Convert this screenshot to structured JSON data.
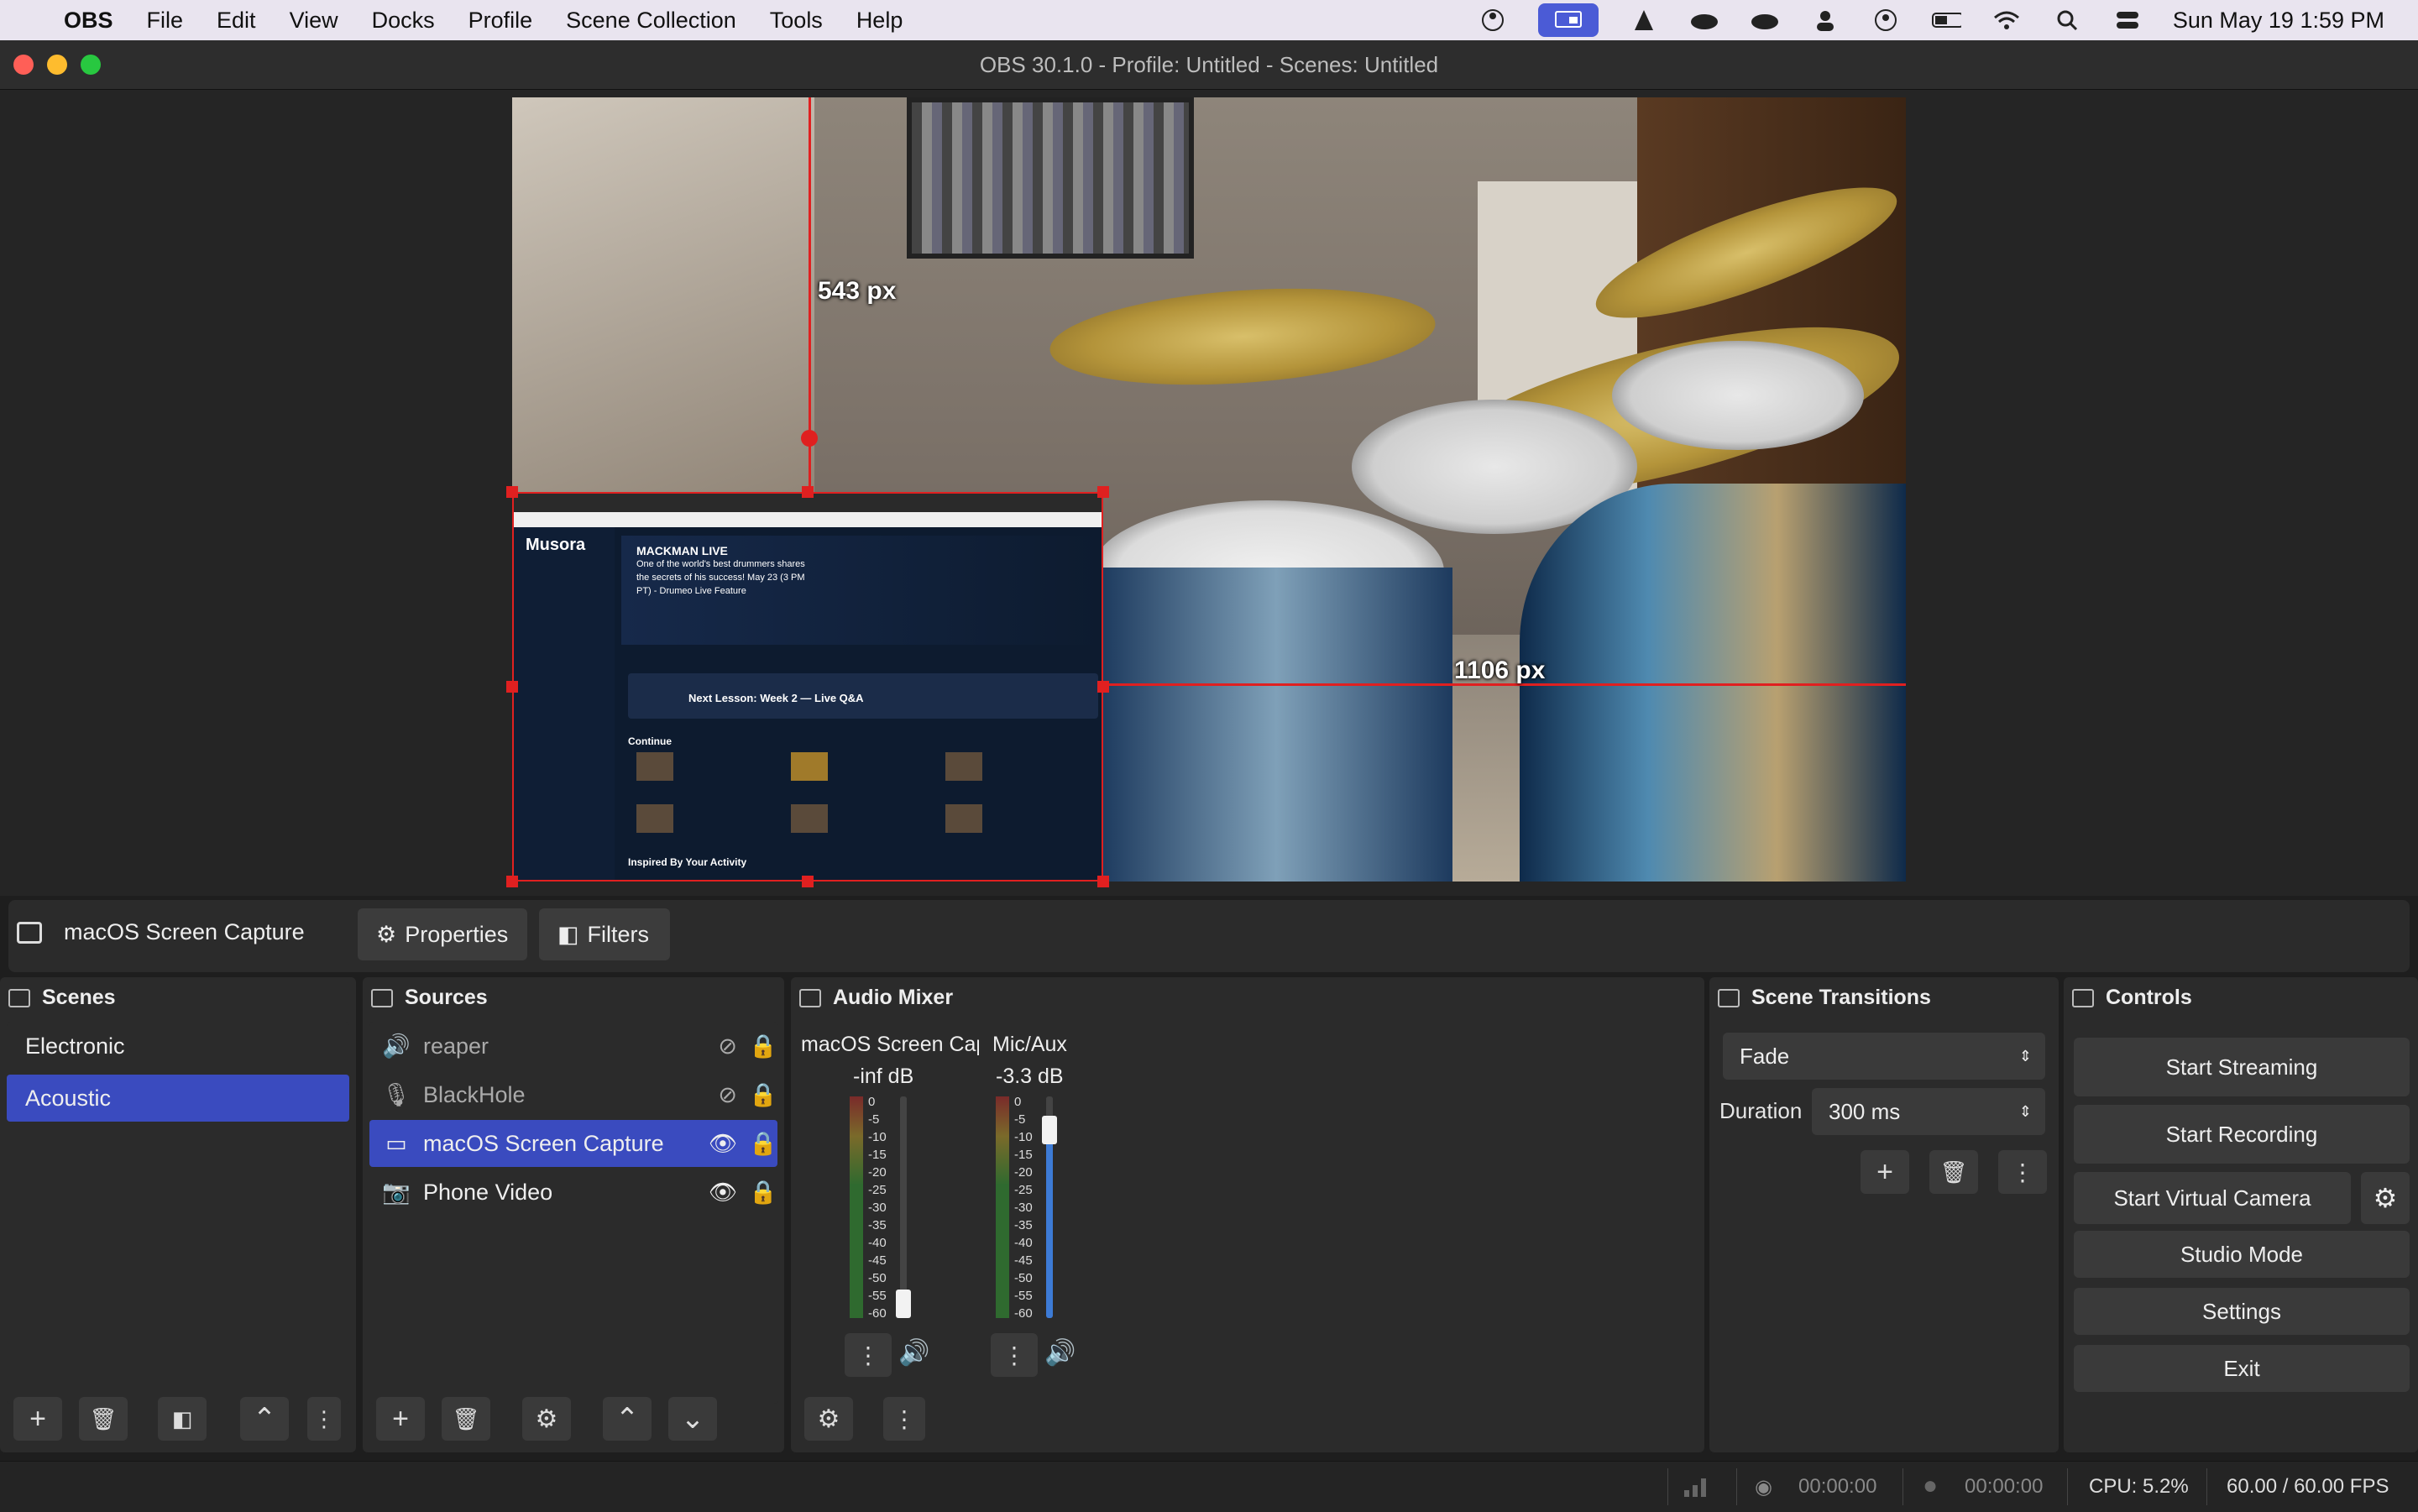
{
  "menubar": {
    "app": "OBS",
    "items": [
      "File",
      "Edit",
      "View",
      "Docks",
      "Profile",
      "Scene Collection",
      "Tools",
      "Help"
    ],
    "datetime": "Sun May 19  1:59 PM"
  },
  "window": {
    "title": "OBS 30.1.0 - Profile: Untitled - Scenes: Untitled"
  },
  "preview": {
    "guide_vertical_label": "543 px",
    "guide_horizontal_label": "1106 px",
    "capture": {
      "logo": "Musora",
      "banner_title": "MACKMAN LIVE",
      "banner_text": "One of the world's best drummers shares the secrets of his success! May 23 (3 PM PT) - Drumeo Live Feature",
      "lesson": "Next Lesson: Week 2 — Live Q&A",
      "continue": "Continue",
      "inspired": "Inspired By Your Activity"
    }
  },
  "source_bar": {
    "selected_source": "macOS Screen Capture",
    "properties_label": "Properties",
    "filters_label": "Filters"
  },
  "scenes": {
    "title": "Scenes",
    "items": [
      "Electronic",
      "Acoustic"
    ],
    "selected": "Acoustic"
  },
  "sources": {
    "title": "Sources",
    "items": [
      {
        "name": "reaper",
        "icon": "speaker-icon",
        "visible": false
      },
      {
        "name": "BlackHole",
        "icon": "microphone-icon",
        "visible": false
      },
      {
        "name": "macOS Screen Capture",
        "icon": "monitor-icon",
        "visible": true
      },
      {
        "name": "Phone Video",
        "icon": "camera-icon",
        "visible": true
      }
    ]
  },
  "audio_mixer": {
    "title": "Audio Mixer",
    "channels": [
      {
        "name": "macOS Screen Capture",
        "db": "-inf dB",
        "fader_level": 0.0
      },
      {
        "name": "Mic/Aux",
        "db": "-3.3 dB",
        "fader_level": 0.9
      }
    ],
    "scale": [
      "0",
      "-5",
      "-10",
      "-15",
      "-20",
      "-25",
      "-30",
      "-35",
      "-40",
      "-45",
      "-50",
      "-55",
      "-60"
    ]
  },
  "scene_transitions": {
    "title": "Scene Transitions",
    "transition": "Fade",
    "duration_label": "Duration",
    "duration_value": "300 ms"
  },
  "controls": {
    "title": "Controls",
    "start_streaming": "Start Streaming",
    "start_recording": "Start Recording",
    "start_virtual_camera": "Start Virtual Camera",
    "studio_mode": "Studio Mode",
    "settings": "Settings",
    "exit": "Exit"
  },
  "status_bar": {
    "stream_time": "00:00:00",
    "record_time": "00:00:00",
    "cpu": "CPU: 5.2%",
    "fps": "60.00 / 60.00 FPS"
  },
  "colors": {
    "accent": "#3a4bbf",
    "guide": "#e02020"
  }
}
